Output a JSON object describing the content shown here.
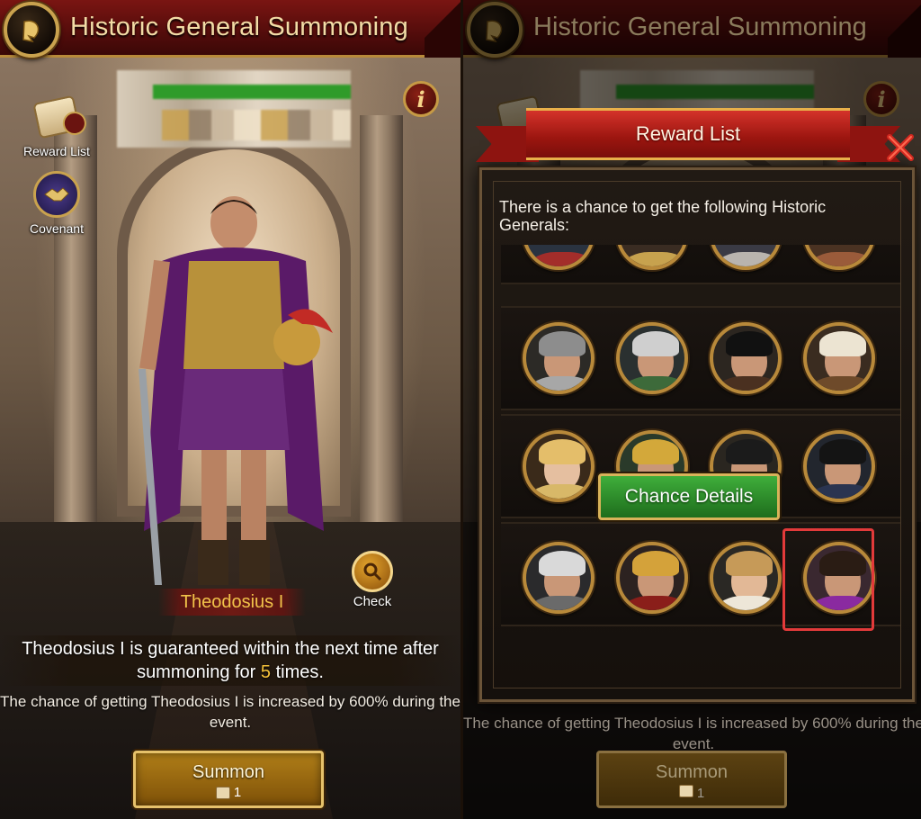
{
  "left": {
    "title": "Historic General Summoning",
    "side_buttons": {
      "reward_list": "Reward List",
      "covenant": "Covenant"
    },
    "hero_name": "Theodosius I",
    "check_label": "Check",
    "guarantee_prefix": "Theodosius I is guaranteed within the next time after summoning for ",
    "guarantee_count": "5",
    "guarantee_suffix": " times.",
    "chance_text": "The chance of getting Theodosius I is increased by 600% during the event.",
    "summon": {
      "label": "Summon",
      "cost": "1"
    }
  },
  "right": {
    "title": "Historic General Summoning",
    "modal": {
      "title": "Reward List",
      "intro": "There is a chance to get the following Historic Generals:",
      "chance_details_label": "Chance Details",
      "generals_rows": [
        [
          "partial-general-1",
          "partial-general-2",
          "partial-general-3",
          "partial-general-4"
        ],
        [
          "armored-knight",
          "grey-bearded-scholar",
          "pirate-captain",
          "turbaned-commander"
        ],
        [
          "blonde-queen",
          "crowned-young-king",
          "tricorn-officer",
          "bicorne-admiral"
        ],
        [
          "white-haired-warrior",
          "crowned-bearded-king",
          "young-prince",
          "theodosius-i"
        ]
      ],
      "highlighted_general": "theodosius-i"
    },
    "background_text": "The chance of getting Theodosius I is increased by 600% during the event.",
    "summon": {
      "label": "Summon",
      "cost": "1"
    }
  },
  "colors": {
    "title_bar": "#6b1210",
    "gold_border": "#c9a24e",
    "highlight_number": "#f5c23a",
    "chance_button": "#2f8f2b",
    "selection_border": "#e23a3a"
  }
}
